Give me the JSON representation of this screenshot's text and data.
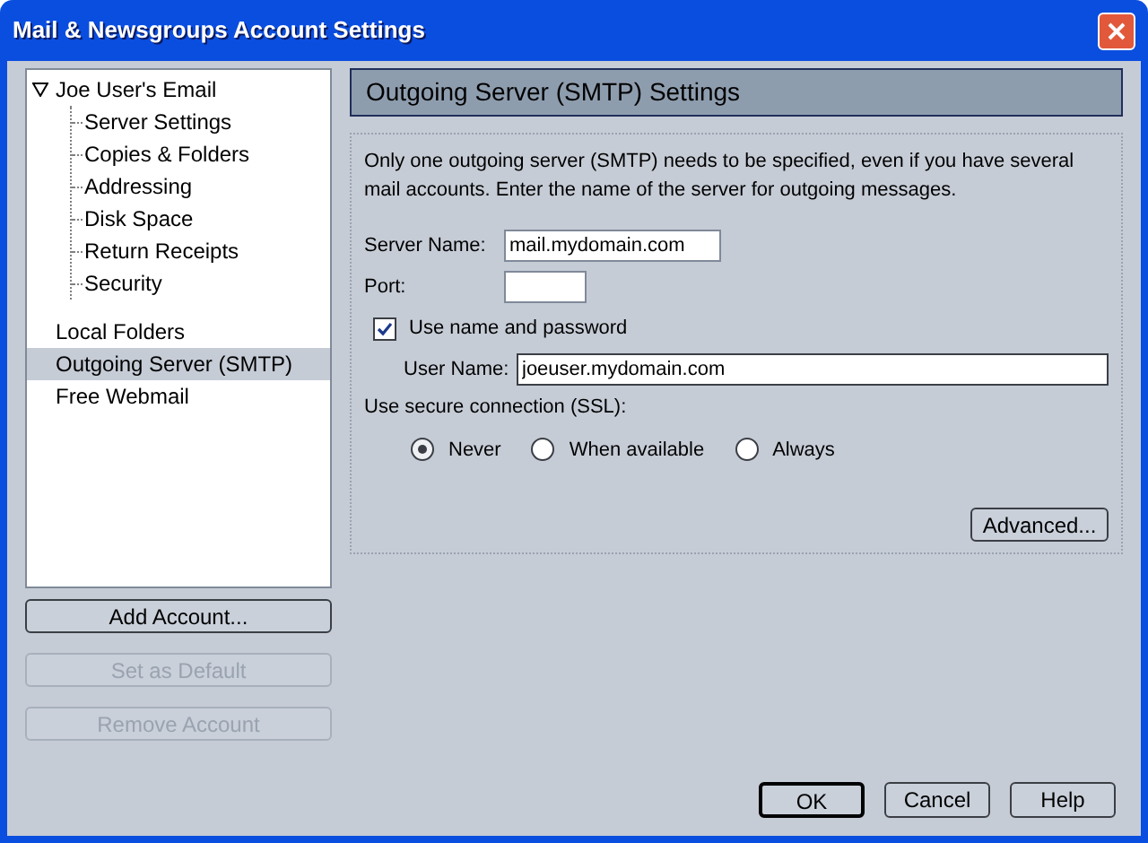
{
  "window": {
    "title": "Mail & Newsgroups Account Settings"
  },
  "tree": [
    {
      "label": "Joe User's Email",
      "expanded": true,
      "selected": false,
      "children": [
        {
          "label": "Server Settings",
          "selected": false
        },
        {
          "label": "Copies & Folders",
          "selected": false
        },
        {
          "label": "Addressing",
          "selected": false
        },
        {
          "label": "Disk Space",
          "selected": false
        },
        {
          "label": "Return Receipts",
          "selected": false
        },
        {
          "label": "Security",
          "selected": false
        }
      ]
    },
    {
      "label": "Local Folders",
      "selected": false
    },
    {
      "label": "Outgoing Server (SMTP)",
      "selected": true
    },
    {
      "label": "Free Webmail",
      "selected": false
    }
  ],
  "account_buttons": [
    {
      "label": "Add Account...",
      "disabled": false
    },
    {
      "label": "Set as Default",
      "disabled": true
    },
    {
      "label": "Remove Account",
      "disabled": true
    }
  ],
  "panel": {
    "title": "Outgoing Server (SMTP) Settings",
    "description": "Only one outgoing server (SMTP) needs to be specified, even if you have several mail accounts. Enter the name of the server for outgoing messages.",
    "server_name": {
      "label": "Server Name:",
      "value": "mail.mydomain.com"
    },
    "port": {
      "label": "Port:"
    },
    "use_name_password": {
      "label": "Use name and password",
      "checked": true
    },
    "user_name": {
      "label": "User Name:",
      "value": "joeuser.mydomain.com"
    },
    "ssl": {
      "label": "Use secure connection (SSL):",
      "options": [
        {
          "label": "Never",
          "selected": true
        },
        {
          "label": "When available",
          "selected": false
        },
        {
          "label": "Always",
          "selected": false
        }
      ]
    },
    "advanced_button": "Advanced..."
  },
  "buttons": [
    {
      "label": "OK",
      "default": true
    },
    {
      "label": "Cancel",
      "default": false
    },
    {
      "label": "Help",
      "default": false
    }
  ]
}
